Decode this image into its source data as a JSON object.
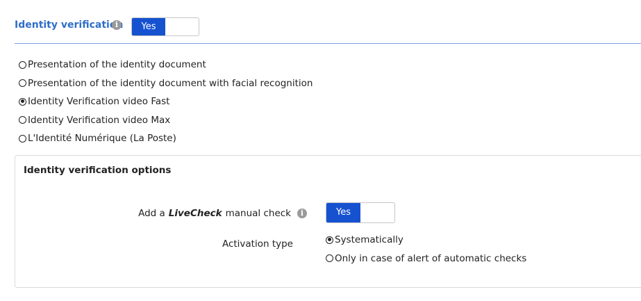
{
  "header": {
    "title": "Identity verification",
    "info_icon": "info-icon",
    "toggle_label": "Yes",
    "accent_color": "#2f6fc9",
    "toggle_color": "#1652d0"
  },
  "methods": [
    {
      "label": "Presentation of the identity document",
      "checked": false
    },
    {
      "label": "Presentation of the identity document with facial recognition",
      "checked": false
    },
    {
      "label": "Identity Verification video Fast",
      "checked": true
    },
    {
      "label": "Identity Verification video Max",
      "checked": false
    },
    {
      "label": "L'Identité Numérique (La Poste)",
      "checked": false
    }
  ],
  "options": {
    "title": "Identity verification options",
    "livecheck": {
      "prefix": "Add a",
      "emphasis": "LiveCheck",
      "suffix": "manual check",
      "toggle_label": "Yes"
    },
    "activation": {
      "label": "Activation type",
      "choices": [
        {
          "label": "Systematically",
          "checked": true
        },
        {
          "label": "Only in case of alert of automatic checks",
          "checked": false
        }
      ]
    }
  }
}
